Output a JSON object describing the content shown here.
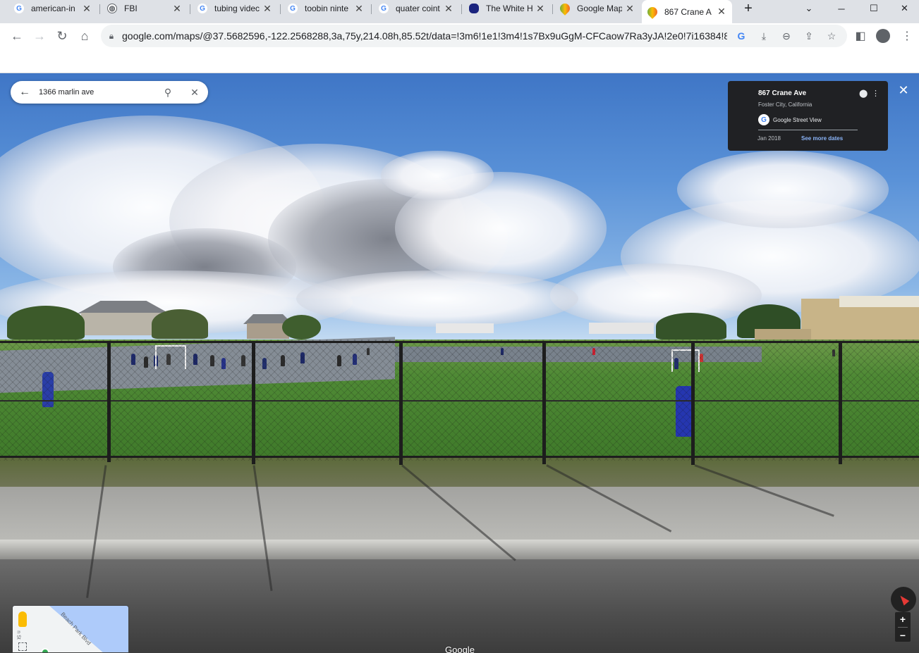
{
  "tabs": [
    {
      "title": "american-in",
      "favicon": "google-icon"
    },
    {
      "title": "FBI",
      "favicon": "globe-icon"
    },
    {
      "title": "tubing videc",
      "favicon": "google-icon"
    },
    {
      "title": "toobin ninte",
      "favicon": "google-icon"
    },
    {
      "title": "quater coint",
      "favicon": "google-icon"
    },
    {
      "title": "The White H",
      "favicon": "whitehouse-icon"
    },
    {
      "title": "Google Map",
      "favicon": "maps-pin-icon"
    },
    {
      "title": "867 Crane A",
      "favicon": "maps-pin-icon",
      "active": true
    }
  ],
  "address_bar": {
    "url": "google.com/maps/@37.5682596,-122.2568288,3a,75y,214.08h,85.52t/data=!3m6!1e1!3m4!1s7Bx9uGgM-CFCaow7Ra3yJA!2e0!7i16384!8i..."
  },
  "maps": {
    "search": {
      "value": "1366 marlin ave"
    },
    "info_card": {
      "title": "867 Crane Ave",
      "subtitle": "Foster City, California",
      "source": "Google Street View",
      "date": "Jan 2018",
      "more_dates": "See more dates"
    },
    "minimap": {
      "road_label": "Beach Park Blvd",
      "street_label": "n St"
    },
    "zoom": {
      "in": "+",
      "out": "−"
    },
    "watermark": "Google"
  }
}
